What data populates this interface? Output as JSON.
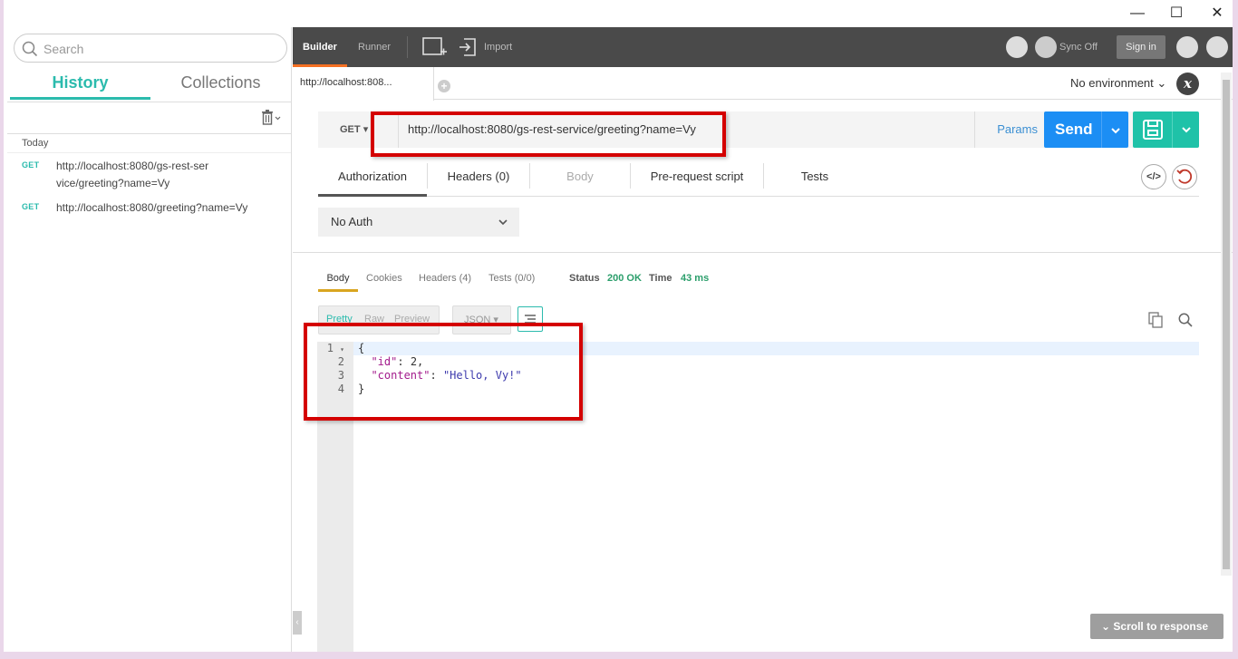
{
  "window": {
    "minimize": "—",
    "maximize": "☐",
    "close": "✕"
  },
  "sidebar": {
    "search_placeholder": "Search",
    "tabs": [
      {
        "label": "History",
        "active": true
      },
      {
        "label": "Collections",
        "active": false
      }
    ],
    "section": "Today",
    "history": [
      {
        "method": "GET",
        "url": "http://localhost:8080/gs-rest-service/greeting?name=Vy"
      },
      {
        "method": "GET",
        "url": "http://localhost:8080/greeting?name=Vy"
      }
    ]
  },
  "toolbar": {
    "builder": "Builder",
    "runner": "Runner",
    "import": "Import",
    "sync": "Sync Off",
    "signin": "Sign in"
  },
  "tabs": {
    "current": "http://localhost:808...",
    "add": "+",
    "environment": "No environment",
    "env_icon": "x"
  },
  "request": {
    "method": "GET",
    "url": "http://localhost:8080/gs-rest-service/greeting?name=Vy",
    "params": "Params",
    "send": "Send",
    "subtabs": [
      "Authorization",
      "Headers (0)",
      "Body",
      "Pre-request script",
      "Tests"
    ],
    "auth": "No Auth",
    "code_icon": "</>"
  },
  "response": {
    "tabs": [
      "Body",
      "Cookies",
      "Headers (4)",
      "Tests (0/0)"
    ],
    "status_label": "Status",
    "status_value": "200 OK",
    "time_label": "Time",
    "time_value": "43 ms",
    "views": [
      "Pretty",
      "Raw",
      "Preview"
    ],
    "format": "JSON",
    "lines": [
      "1",
      "2",
      "3",
      "4"
    ],
    "code": {
      "open": "{",
      "id_key": "\"id\"",
      "id_sep": ": ",
      "id_val": "2",
      "id_comma": ",",
      "content_key": "\"content\"",
      "content_sep": ": ",
      "content_val": "\"Hello, Vy!\"",
      "close": "}"
    },
    "scroll_to_response": "Scroll to response"
  },
  "colors": {
    "accent": "#2bbbad",
    "send": "#1c8ef4",
    "save": "#1fc2a8",
    "highlight": "#d40000",
    "toolbar": "#4a4a4a"
  }
}
